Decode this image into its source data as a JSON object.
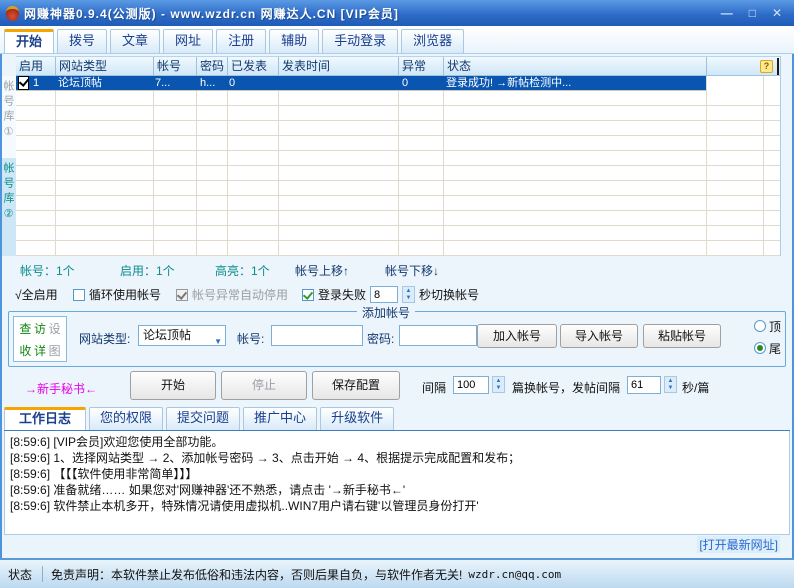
{
  "colors": {
    "accent_orange": "#f5a400",
    "selection_blue": "#0a55b0",
    "teal": "#0b8b8b",
    "magenta": "#e800e8",
    "green_check": "#2ca02c",
    "link_blue": "#2a6ad0"
  },
  "icons": {
    "help": "?",
    "dropdown_arrow": "▼",
    "spinner_up": "▲",
    "spinner_down": "▼"
  },
  "window": {
    "title": "网赚神器0.9.4(公测版) - www.wzdr.cn 网赚达人.CN [VIP会员]",
    "minimize": "—",
    "maximize": "□",
    "close": "✕"
  },
  "menu": {
    "tabs": [
      {
        "label": "开始"
      },
      {
        "label": "拨号"
      },
      {
        "label": "文章"
      },
      {
        "label": "网址"
      },
      {
        "label": "注册"
      },
      {
        "label": "辅助"
      },
      {
        "label": "手动登录"
      },
      {
        "label": "浏览器"
      }
    ]
  },
  "side_tabs": {
    "tab1": "帐号库①",
    "tab2": "帐号库②"
  },
  "table": {
    "headers": [
      "启用",
      "网站类型",
      "帐号",
      "密码",
      "已发表",
      "发表时间",
      "异常",
      "状态"
    ],
    "row": {
      "index": "1",
      "site_type": "论坛顶帖",
      "account": "7...",
      "password": "h...",
      "published": "0",
      "publish_time": "",
      "error": "0",
      "status": "登录成功! →新帖检测中..."
    }
  },
  "stats": {
    "accounts": "帐号：1个",
    "enabled": "启用：1个",
    "highlight": "高亮：1个",
    "move_up": "帐号上移↑",
    "move_down": "帐号下移↓"
  },
  "options": {
    "all_enable": "√全启用",
    "cycle_accounts": "循环使用帐号",
    "auto_stop": "帐号异常自动停用",
    "login_fail": "登录失败",
    "switch_seconds": "8",
    "switch_suffix": "秒切换帐号"
  },
  "add_account": {
    "group_label": "添加帐号",
    "quick": [
      "查",
      "访",
      "设",
      "收",
      "详",
      "图"
    ],
    "site_type_label": "网站类型:",
    "site_type_value": "论坛顶帖",
    "account_label": "帐号:",
    "password_label": "密码:",
    "add_button": "加入帐号",
    "import_button": "导入帐号",
    "paste_button": "粘贴帐号",
    "radio_top": "顶",
    "radio_tail": "尾"
  },
  "actions": {
    "newbie": "→新手秘书←",
    "start": "开始",
    "stop": "停止",
    "save": "保存配置",
    "interval_label": "间隔",
    "interval_value": "100",
    "interval_mid": "篇换帐号，发帖间隔",
    "post_interval_value": "61",
    "interval_suffix": "秒/篇"
  },
  "bottom_tabs": [
    {
      "label": "工作日志"
    },
    {
      "label": "您的权限"
    },
    {
      "label": "提交问题"
    },
    {
      "label": "推广中心"
    },
    {
      "label": "升级软件"
    }
  ],
  "log": {
    "lines": [
      "[8:59:6]  [VIP会员]欢迎您使用全部功能。",
      "[8:59:6]  1、选择网站类型 → 2、添加帐号密码 → 3、点击开始 → 4、根据提示完成配置和发布；",
      "[8:59:6]  【【【软件使用非常简单】】】",
      "[8:59:6]  准备就绪…… 如果您对'网赚神器'还不熟悉，请点击 '→新手秘书←'",
      "[8:59:6]  软件禁止本机多开，特殊情况请使用虚拟机..WIN7用户请右键'以管理员身份打开'"
    ]
  },
  "open_latest_link": "[打开最新网址]",
  "status_bar": {
    "label": "状态",
    "disclaimer": "免责声明：本软件禁止发布低俗和违法内容，否则后果自负，与软件作者无关!",
    "email": "wzdr.cn@qq.com"
  }
}
